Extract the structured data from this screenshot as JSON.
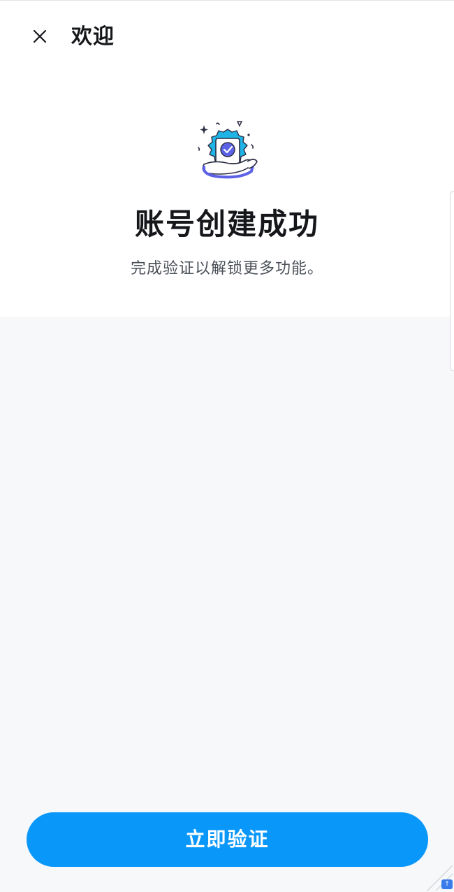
{
  "header": {
    "close_icon": "close-icon",
    "title": "欢迎"
  },
  "hero": {
    "illustration_icon": "verified-badge-hand-icon",
    "headline": "账号创建成功",
    "subtext": "完成验证以解锁更多功能。"
  },
  "footer": {
    "verify_button_label": "立即验证"
  },
  "colors": {
    "primary": "#0a97fa",
    "badge_teal": "#1fb4e6",
    "badge_inner": "#5b62e6",
    "text_primary": "#15171a",
    "text_secondary": "#4a4f57",
    "background": "#f7f8fa",
    "panel": "#ffffff"
  }
}
